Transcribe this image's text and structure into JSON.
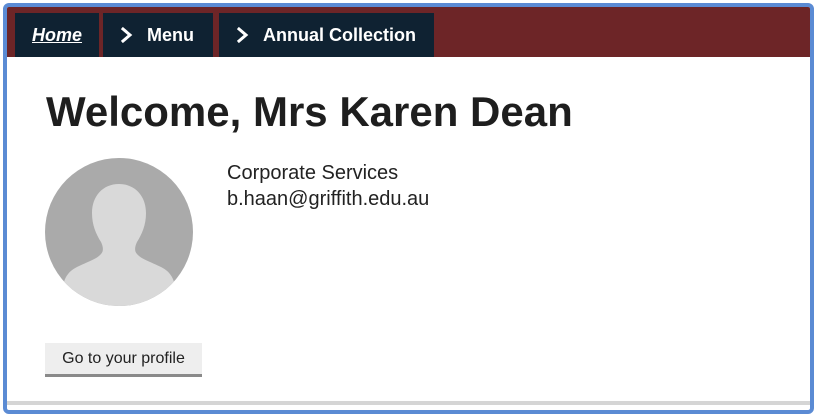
{
  "breadcrumb": {
    "home_label": "Home",
    "menu_label": "Menu",
    "annual_label": "Annual Collection"
  },
  "page": {
    "welcome_title": "Welcome, Mrs Karen Dean"
  },
  "profile": {
    "department": "Corporate Services",
    "email": "b.haan@griffith.edu.au",
    "button_label": "Go to your profile"
  },
  "colors": {
    "frame_border": "#5b8bd4",
    "topbar_background": "#6d2527",
    "crumb_background": "#0f2232",
    "avatar_background": "#aaaaaa",
    "avatar_silhouette": "#d9d9d9"
  },
  "icons": {
    "breadcrumb_separator": "chevron-right-icon",
    "avatar": "user-silhouette-icon"
  }
}
